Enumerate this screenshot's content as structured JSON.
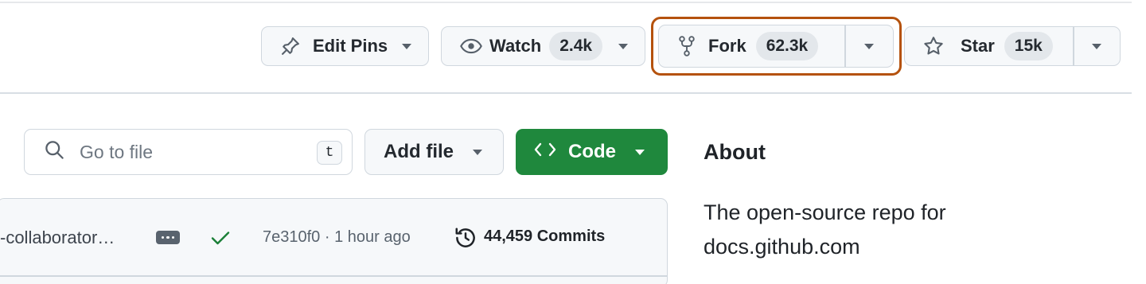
{
  "header_actions": {
    "edit_pins": {
      "label": "Edit Pins",
      "icon": "pin-icon"
    },
    "watch": {
      "label": "Watch",
      "count": "2.4k",
      "icon": "eye-icon"
    },
    "fork": {
      "label": "Fork",
      "count": "62.3k",
      "icon": "repo-forked-icon",
      "highlighted": true,
      "highlight_color": "#b5520d"
    },
    "star": {
      "label": "Star",
      "count": "15k",
      "icon": "star-icon"
    }
  },
  "toolbar": {
    "search": {
      "placeholder": "Go to file",
      "value": "",
      "shortcut": "t",
      "icon": "search-icon"
    },
    "add_file": {
      "label": "Add file"
    },
    "code": {
      "label": "Code",
      "icon": "code-icon",
      "color": "#1f883d"
    }
  },
  "latest_commit": {
    "message": "-collaborator…",
    "status": "success",
    "status_color": "#1a7f37",
    "sha": "7e310f0",
    "time": "1 hour ago",
    "meta_separator": " · ",
    "commits_count": "44,459 Commits"
  },
  "about": {
    "title": "About",
    "description": "The open-source repo for docs.github.com"
  },
  "colors": {
    "button_bg": "#f6f8fa",
    "border": "#d0d7de",
    "text": "#1f2328",
    "muted": "#59636e"
  }
}
